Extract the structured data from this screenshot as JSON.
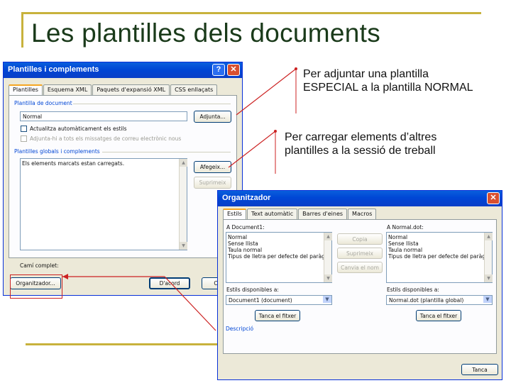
{
  "slide": {
    "title": "Les plantilles dels documents",
    "annotation_1": "Per adjuntar una plantilla ESPECIAL a la plantilla NORMAL",
    "annotation_2": "Per carregar elements d’altres plantilles a la sessió de treball",
    "accent_color": "#c8b23c",
    "arrow_color": "#cc2222"
  },
  "dialog1": {
    "title": "Plantilles i complements",
    "help_label": "?",
    "close_label": "✕",
    "tabs": [
      "Plantilles",
      "Esquema XML",
      "Paquets d'expansió XML",
      "CSS enllaçats"
    ],
    "doc_template_group": "Plantilla de document",
    "doc_template_value": "Normal",
    "attach_button": "Adjunta...",
    "auto_update_label": "Actualitza automàticament els estils",
    "attach_all_label": "Adjunta-hi a tots els missatges de correu electrònic nous",
    "global_group": "Plantilles globals i complements",
    "checked_note": "Els elements marcats estan carregats.",
    "add_button": "Afegeix...",
    "remove_button": "Suprimeix",
    "full_path_label": "Camí complet:",
    "organizer_button": "Organitzador...",
    "ok_button": "D'acord",
    "cancel_button": "C"
  },
  "dialog2": {
    "title": "Organitzador",
    "close_label": "✕",
    "tabs": [
      "Estils",
      "Text automàtic",
      "Barres d'eines",
      "Macros"
    ],
    "left_label": "A Document1:",
    "left_items": [
      "Normal",
      "Sense llista",
      "Taula normal",
      "Tipus de lletra per defecte del paràgr"
    ],
    "right_label": "A Normal.dot:",
    "right_items": [
      "Normal",
      "Sense llista",
      "Taula normal",
      "Tipus de lletra per defecte del paràgr"
    ],
    "copy_button": "Copia",
    "delete_button": "Suprimeix",
    "rename_button": "Canvia el nom",
    "left_available_label": "Estils disponibles a:",
    "left_available_value": "Document1 (document)",
    "right_available_label": "Estils disponibles a:",
    "right_available_value": "Normal.dot (plantilla global)",
    "left_close_file": "Tanca el fitxer",
    "right_close_file": "Tanca el fitxer",
    "description_label": "Descripció",
    "close_button": "Tanca"
  }
}
